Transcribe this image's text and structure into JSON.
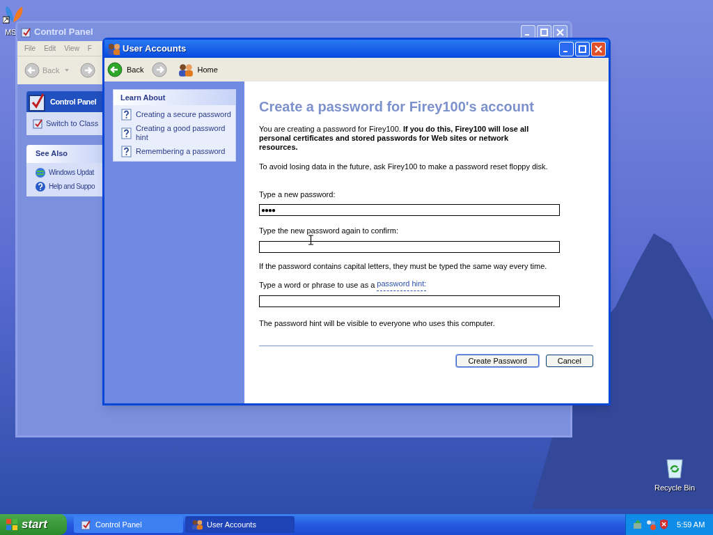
{
  "desktop": {
    "icons": [
      {
        "label": "MS",
        "kind": "shortcut"
      },
      {
        "label": "Recycle Bin",
        "kind": "recycle"
      }
    ]
  },
  "control_panel": {
    "title": "Control Panel",
    "menu": [
      "File",
      "Edit",
      "View",
      "F"
    ],
    "back": "Back",
    "panel_title": "Control Panel",
    "panel_items": [
      "Switch to Class"
    ],
    "see_also_title": "See Also",
    "see_also": [
      {
        "label": "Windows Updat",
        "kind": "update"
      },
      {
        "label": "Help and Suppo",
        "kind": "help"
      }
    ]
  },
  "user_accounts": {
    "title": "User Accounts",
    "back": "Back",
    "home": "Home",
    "learn_title": "Learn About",
    "learn_items": [
      "Creating a secure password",
      "Creating a good password hint",
      "Remembering a password"
    ],
    "heading": "Create a password for Firey100's account",
    "intro": "You are creating a password for Firey100. **If you do this, Firey100 will lose all personal certificates and stored passwords for Web sites or network resources.**",
    "advice": "To avoid losing data in the future, ask Firey100 to make a password reset floppy disk.",
    "new_password": {
      "label": "Type a new password:",
      "value": "●●●●"
    },
    "confirm": {
      "label": "Type the new password again to confirm:"
    },
    "case_note": "If the password contains capital letters, they must be typed the same way every time.",
    "hint": {
      "label": "Type a word or phrase to use as a",
      "link": "password hint:"
    },
    "hint_note": "The password hint will be visible to everyone who uses this computer.",
    "buttons": [
      {
        "label": "Create Password",
        "default": true
      },
      {
        "label": "Cancel",
        "default": false
      }
    ]
  },
  "taskbar": {
    "start": "start",
    "tasks": [
      {
        "label": "Control Panel",
        "selected": false,
        "kind": "control"
      },
      {
        "label": "User Accounts",
        "selected": true,
        "kind": "users"
      }
    ],
    "clock": "5:59 AM"
  }
}
